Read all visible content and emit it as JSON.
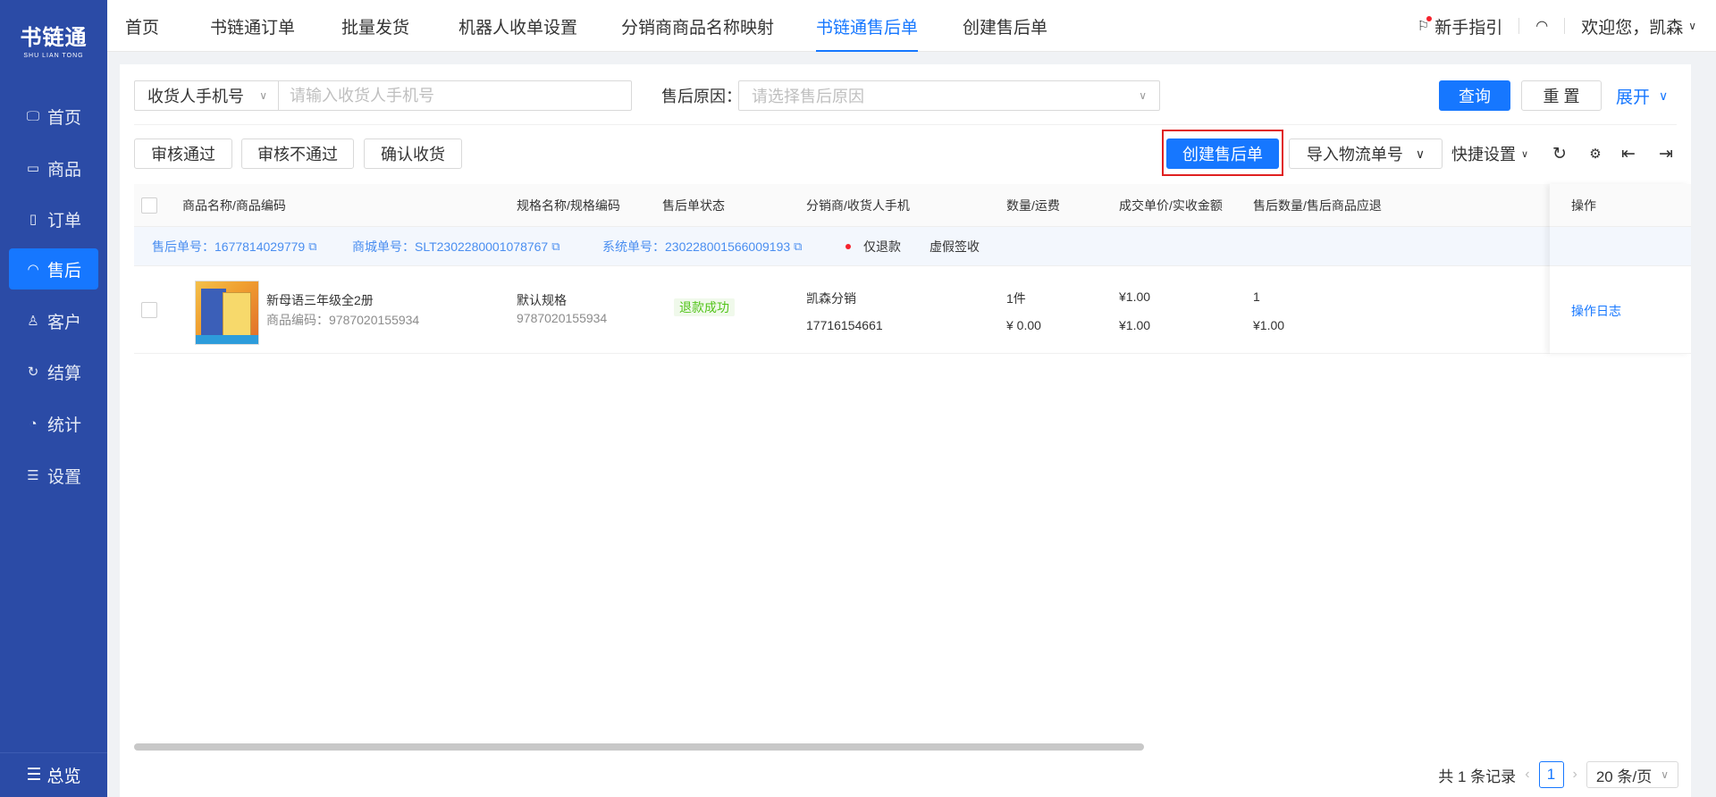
{
  "app": {
    "logo_cn": "书链通",
    "logo_en": "SHU LIAN TONG"
  },
  "sidebar": {
    "items": [
      {
        "label": "首页",
        "icon": "monitor-icon",
        "active": false
      },
      {
        "label": "商品",
        "icon": "box-icon",
        "active": false
      },
      {
        "label": "订单",
        "icon": "document-icon",
        "active": false
      },
      {
        "label": "售后",
        "icon": "headset-icon",
        "active": true
      },
      {
        "label": "客户",
        "icon": "user-icon",
        "active": false
      },
      {
        "label": "结算",
        "icon": "refresh-icon",
        "active": false
      },
      {
        "label": "统计",
        "icon": "pie-chart-icon",
        "active": false
      },
      {
        "label": "设置",
        "icon": "sliders-icon",
        "active": false
      }
    ],
    "footer_label": "总览"
  },
  "topbar": {
    "tabs": [
      {
        "label": "首页",
        "active": false
      },
      {
        "label": "书链通订单",
        "active": false
      },
      {
        "label": "批量发货",
        "active": false
      },
      {
        "label": "机器人收单设置",
        "active": false
      },
      {
        "label": "分销商商品名称映射",
        "active": false
      },
      {
        "label": "书链通售后单",
        "active": true
      },
      {
        "label": "创建售后单",
        "active": false
      }
    ],
    "guide_label": "新手指引",
    "welcome": "欢迎您，凯森"
  },
  "filters": {
    "field_select": "收货人手机号",
    "field_placeholder": "请输入收货人手机号",
    "reason_label": "售后原因：",
    "reason_placeholder": "请选择售后原因",
    "query_label": "查询",
    "reset_label": "重 置",
    "expand_label": "展开"
  },
  "actions": {
    "approve": "审核通过",
    "reject": "审核不通过",
    "confirm_receipt": "确认收货",
    "create": "创建售后单",
    "import_logistics": "导入物流单号",
    "quick_settings": "快捷设置"
  },
  "table": {
    "headers": {
      "product": "商品名称/商品编码",
      "spec": "规格名称/规格编码",
      "status": "售后单状态",
      "distributor": "分销商/收货人手机",
      "qty": "数量/运费",
      "price": "成交单价/实收金额",
      "refund": "售后数量/售后商品应退",
      "op": "操作"
    },
    "group": {
      "aftersale_no": "售后单号：1677814029779",
      "mall_no": "商城单号：SLT2302280001078767",
      "system_no": "系统单号：230228001566009193",
      "type": "仅退款",
      "fake_sign": "虚假签收"
    },
    "row": {
      "product_name": "新母语三年级全2册",
      "product_code": "商品编码：9787020155934",
      "spec_name": "默认规格",
      "spec_code": "9787020155934",
      "status": "退款成功",
      "distributor": "凯森分销",
      "phone": "17716154661",
      "qty": "1件",
      "freight": "¥ 0.00",
      "unit_price": "¥1.00",
      "received": "¥1.00",
      "refund_qty": "1",
      "refund_amount": "¥1.00",
      "op_link": "操作日志"
    }
  },
  "pagination": {
    "total": "共 1 条记录",
    "current_page": "1",
    "page_size": "20 条/页"
  },
  "colors": {
    "sidebar": "#2b4ba6",
    "primary": "#1677ff",
    "highlight": "#e02020"
  }
}
